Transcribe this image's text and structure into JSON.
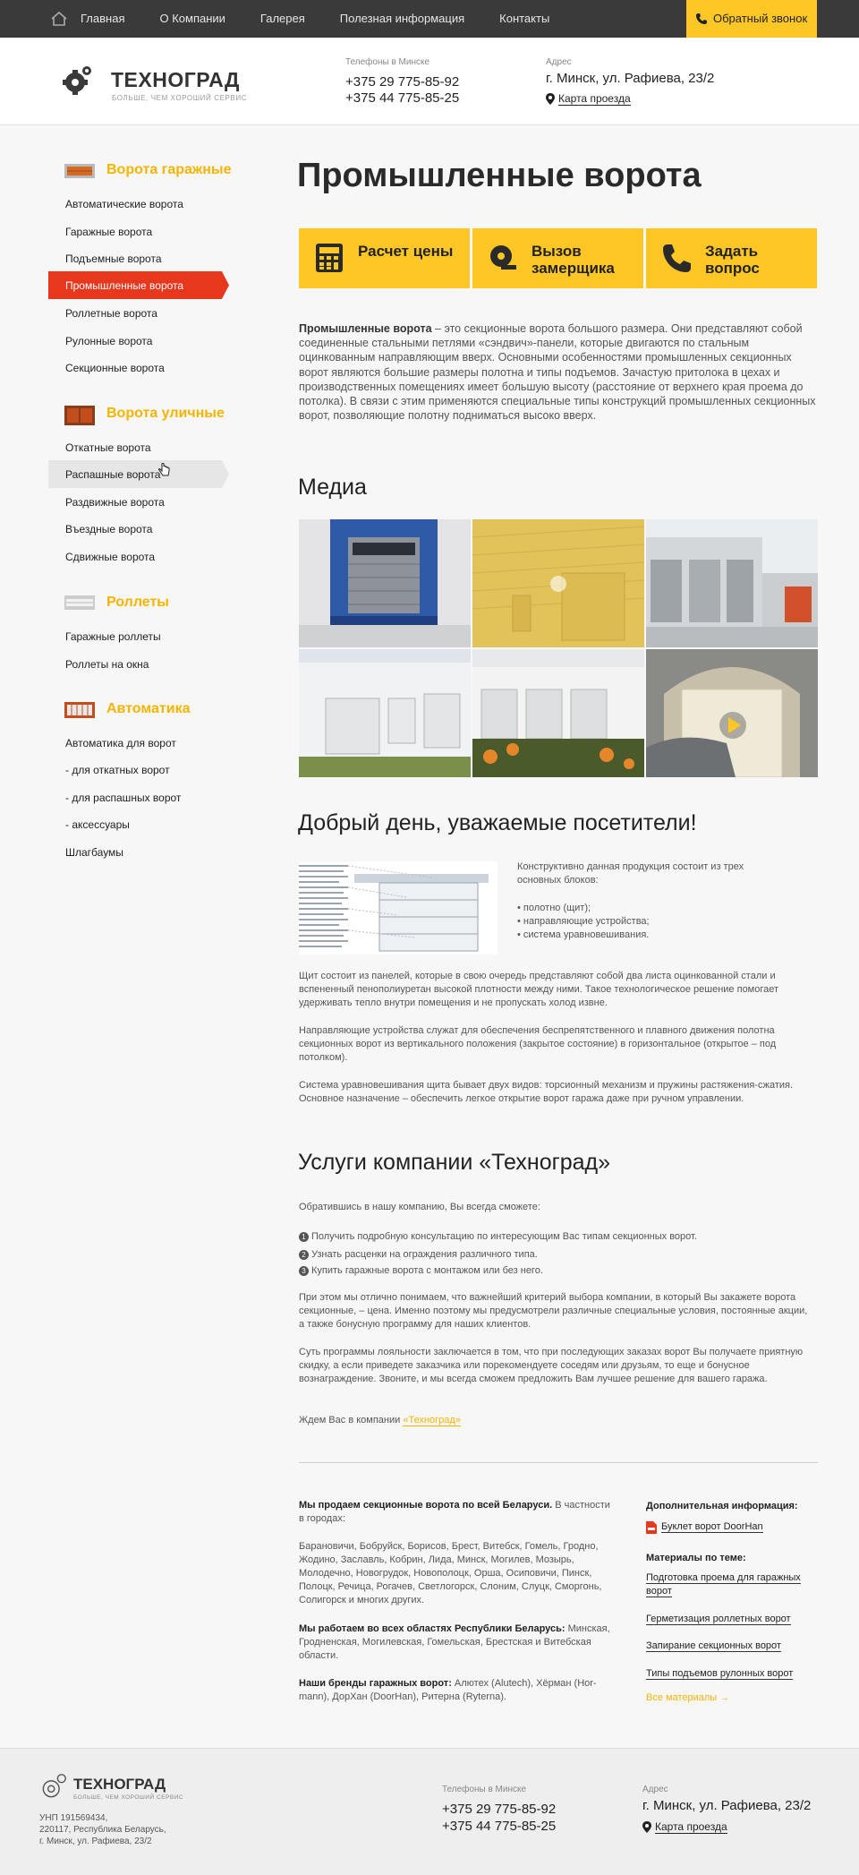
{
  "topnav": {
    "items": [
      "Главная",
      "О Компании",
      "Галерея",
      "Полезная информация",
      "Контакты"
    ],
    "callback": "Обратный звонок"
  },
  "header": {
    "logo_title": "ТЕХНОГРАД",
    "logo_sub": "БОЛЬШЕ, ЧЕМ ХОРОШИЙ СЕРВИС",
    "phones_label": "Телефоны в Минске",
    "phone1": "+375 29 775-85-92",
    "phone2": "+375 44 775-85-25",
    "addr_label": "Адрес",
    "address": "г. Минск, ул. Рафиева, 23/2",
    "map_link": "Карта проезда"
  },
  "sidebar": {
    "s1": {
      "title": "Ворота гаражные",
      "items": [
        "Автоматические ворота",
        "Гаражные ворота",
        "Подъемные ворота",
        "Промышленные ворота",
        "Роллетные ворота",
        "Рулонные ворота",
        "Секционные ворота"
      ]
    },
    "s2": {
      "title": "Ворота уличные",
      "items": [
        "Откатные ворота",
        "Распашные ворота",
        "Раздвижные ворота",
        "Въездные ворота",
        "Сдвижные ворота"
      ]
    },
    "s3": {
      "title": "Роллеты",
      "items": [
        "Гаражные роллеты",
        "Роллеты на окна"
      ]
    },
    "s4": {
      "title": "Автоматика",
      "items": [
        "Автоматика для ворот",
        "- для откатных ворот",
        "- для распашных ворот",
        "- аксессуары",
        "Шлагбаумы"
      ]
    }
  },
  "main": {
    "title": "Промышленные ворота",
    "buttons": [
      "Расчет цены",
      "Вызов замерщика",
      "Задать вопрос"
    ],
    "intro_bold": "Промышленные ворота",
    "intro_rest": " – это секционные ворота большого размера. Они представляют собой соединенные стальными петлями «сэндвич»-панели, которые двигаются по стальным оцинкованным направляющим вверх. Основными особенностями промышленных секционных ворот являются большие размеры полотна и типы подъемов. Зачастую притолока в цехах и производственных помещениях имеет большую высоту (расстояние от верхнего края проема до потолка). В связи с этим применяются специальные типы конструкций промышленных секционных ворот, позволяющие полотну подниматься высоко вверх.",
    "media_title": "Медиа",
    "welcome_title": "Добрый день, уважаемые посетители!",
    "blocks_intro": "Конструктивно данная продукция состоит из трех основных блоков:",
    "blocks": [
      "• полотно (щит);",
      "• направляющие устройства;",
      "• система уравновешивания."
    ],
    "p1": "Щит состоит из панелей, которые в свою очередь представляют собой два листа оцинкованной стали и вспененный пенополиуретан высокой плотности между ними. Такое технологическое решение помогает удерживать тепло внутри помещения и не пропускать холод извне.",
    "p2": "Направляющие устройства служат для обеспечения беспрепятственного и плавного движения полотна секционных ворот из вертикального положения (закрытое состояние) в горизонтальное (открытое – под потолком).",
    "p3": "Система уравновешивания щита бывает двух видов: торсионный механизм и пружины растяжения-сжатия. Основное назначение – обеспечить легкое открытие ворот гаража даже при ручном управлении.",
    "services_title": "Услуги компании «Техноград»",
    "s_intro": "Обратившись в нашу компанию, Вы всегда сможете:",
    "s_list": [
      "Получить подробную консультацию по интересующим Вас типам секционных ворот.",
      "Узнать расценки на ограждения различного типа.",
      "Купить гаражные ворота с монтажом или без него."
    ],
    "s_p1": "При этом мы отлично понимаем, что важнейший критерий выбора компании, в который Вы закажете ворота секционные, – цена. Именно поэтому мы предусмотрели различные специальные условия, постоянные акции, а также бонусную программу для наших клиентов.",
    "s_p2": "Суть программы лояльности заключается в том, что при последующих заказах ворот Вы получаете приятную скидку, а если приведете заказчика или порекомендуете соседям или друзьям, то еще и бонусное вознаграждение. Звоните, и мы всегда сможем предложить Вам лучшее решение для вашего гаража.",
    "s_wait": "Ждем Вас в компании ",
    "s_wait_link": "«Техноград»"
  },
  "bottom": {
    "sell_bold": "Мы продаем секционные ворота по всей Беларуси.",
    "sell_rest": " В частности в городах:",
    "cities": "Барановичи, Бобруйск, Борисов, Брест, Витебск, Гомель, Гродно, Жодино, Заславль, Кобрин, Лида, Минск, Могилев, Мозырь, Молодечно, Новогрудок, Новополоцк, Орша, Осиповичи, Пинск, Полоцк, Речица, Рогачев, Светлогорск, Слоним, Слуцк, Сморгонь, Солигорск и многих других.",
    "regions_bold": "Мы работаем во всех областях Республики Беларусь:",
    "regions_rest": " Минская, Гродненская, Могилевская, Гомельская, Брестская и Витебская области.",
    "brands_bold": "Наши бренды гаражных ворот:",
    "brands_rest": " Алютех (Alutech), Хёрман (Hor- mann), ДорХан (DoorHan), Ритерна (Ryterna).",
    "add_title": "Дополнительная информация:",
    "booklet": "Буклет ворот DoorHan",
    "mat_title": "Материалы по теме:",
    "materials": [
      "Подготовка проема для гаражных ворот",
      "Герметизация роллетных ворот",
      "Запирание секционных ворот",
      "Типы подъемов рулонных ворот"
    ],
    "all": "Все материалы →"
  },
  "footer": {
    "logo_title": "ТЕХНОГРАД",
    "logo_sub": "БОЛЬШЕ, ЧЕМ ХОРОШИЙ СЕРВИС",
    "unp": "УНП 191569434,",
    "zip": "220117, Республика Беларусь,",
    "street": "г. Минск, ул. Рафиева, 23/2",
    "phones_label": "Телефоны в Минске",
    "phone1": "+375 29 775-85-92",
    "phone2": "+375 44 775-85-25",
    "addr_label": "Адрес",
    "address": "г. Минск, ул. Рафиева, 23/2",
    "map_link": "Карта проезда"
  },
  "colors": {
    "accent": "#ffc726",
    "active": "#e7381e",
    "dark": "#3a3a3a"
  }
}
